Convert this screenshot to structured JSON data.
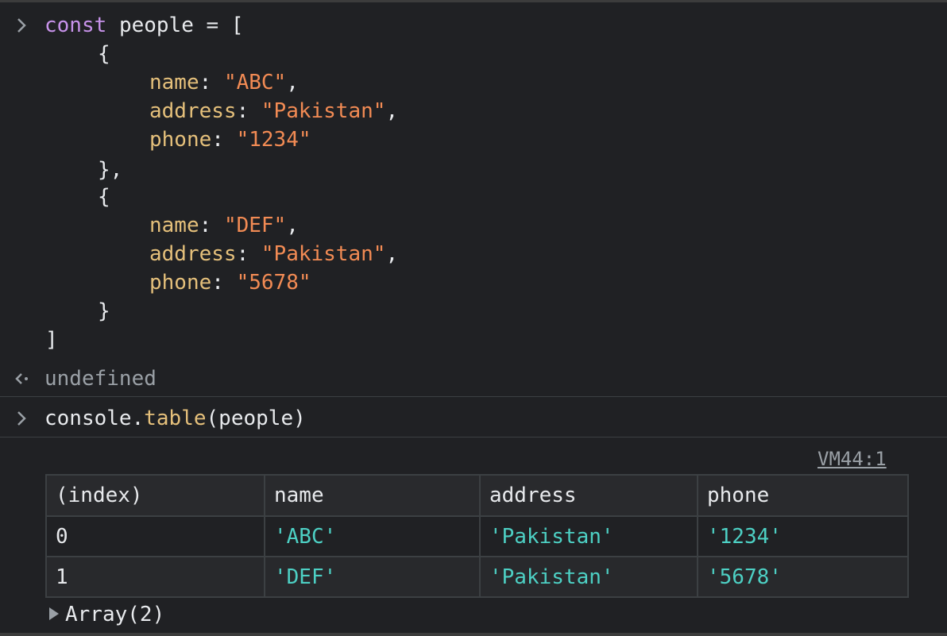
{
  "input1": {
    "line1": {
      "keyword": "const",
      "name": "people",
      "eq": "=",
      "open": "["
    },
    "obj1": {
      "open": "{",
      "name_key": "name",
      "name_val": "\"ABC\"",
      "address_key": "address",
      "address_val": "\"Pakistan\"",
      "phone_key": "phone",
      "phone_val": "\"1234\"",
      "close": "},"
    },
    "obj2": {
      "open": "{",
      "name_key": "name",
      "name_val": "\"DEF\"",
      "address_key": "address",
      "address_val": "\"Pakistan\"",
      "phone_key": "phone",
      "phone_val": "\"5678\"",
      "close": "}"
    },
    "close": "]"
  },
  "result1": "undefined",
  "input2": {
    "object": "console",
    "method": "table",
    "arg": "people"
  },
  "source_link": "VM44:1",
  "table": {
    "headers": [
      "(index)",
      "name",
      "address",
      "phone"
    ],
    "rows": [
      [
        "0",
        "'ABC'",
        "'Pakistan'",
        "'1234'"
      ],
      [
        "1",
        "'DEF'",
        "'Pakistan'",
        "'5678'"
      ]
    ]
  },
  "array_label": "Array(2)",
  "colors": {
    "background": "#202124",
    "keyword": "#c792ea",
    "property": "#e5c07b",
    "string": "#f28b54",
    "table_string": "#4dd0c4",
    "muted": "#9aa0a6"
  }
}
